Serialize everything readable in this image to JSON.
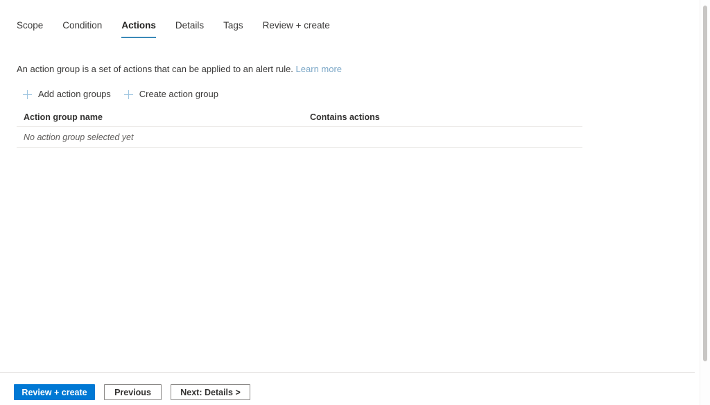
{
  "wizard": {
    "tabs": [
      {
        "label": "Scope",
        "active": false
      },
      {
        "label": "Condition",
        "active": false
      },
      {
        "label": "Actions",
        "active": true
      },
      {
        "label": "Details",
        "active": false
      },
      {
        "label": "Tags",
        "active": false
      },
      {
        "label": "Review + create",
        "active": false
      }
    ]
  },
  "description": {
    "text": "An action group is a set of actions that can be applied to an alert rule.",
    "link_label": "Learn more"
  },
  "commands": [
    {
      "label": "Add action groups",
      "icon": "plus-icon"
    },
    {
      "label": "Create action group",
      "icon": "plus-icon"
    }
  ],
  "table": {
    "columns": [
      {
        "label": "Action group name"
      },
      {
        "label": "Contains actions"
      }
    ],
    "empty_message": "No action group selected yet"
  },
  "footer": {
    "review_label": "Review + create",
    "previous_label": "Previous",
    "next_label": "Next: Details >"
  },
  "colors": {
    "accent": "#0078d4",
    "tab_underline": "#3a89b8",
    "link": "#7ba7c7",
    "plus": "#9ec5e0",
    "border": "#edebe9"
  }
}
